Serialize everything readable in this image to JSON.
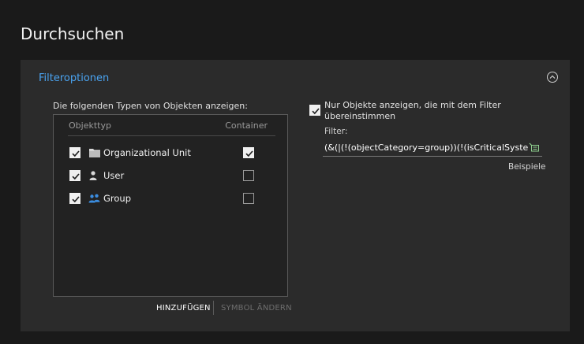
{
  "page": {
    "title": "Durchsuchen"
  },
  "filter_panel": {
    "header": "Filteroptionen",
    "types_label": "Die folgenden Typen von Objekten anzeigen:",
    "columns": {
      "object_type": "Objekttyp",
      "container": "Container"
    },
    "rows": [
      {
        "label": "Organizational Unit",
        "icon": "folder-icon",
        "shown": true,
        "container": true
      },
      {
        "label": "User",
        "icon": "user-icon",
        "shown": true,
        "container": false
      },
      {
        "label": "Group",
        "icon": "group-icon",
        "shown": true,
        "container": false
      }
    ],
    "add_button": "HINZUFÜGEN",
    "change_icon_button": "SYMBOL ÄNDERN",
    "filter_checkbox_checked": true,
    "filter_checkbox_label": "Nur Objekte anzeigen, die mit dem Filter übereinstimmen",
    "filter_field_label": "Filter:",
    "filter_value": "(&(|(!(objectCategory=group))(!(isCriticalSystemOb",
    "examples_link": "Beispiele"
  },
  "colors": {
    "accent": "#4aa3f0",
    "group_icon": "#3b8de0"
  }
}
